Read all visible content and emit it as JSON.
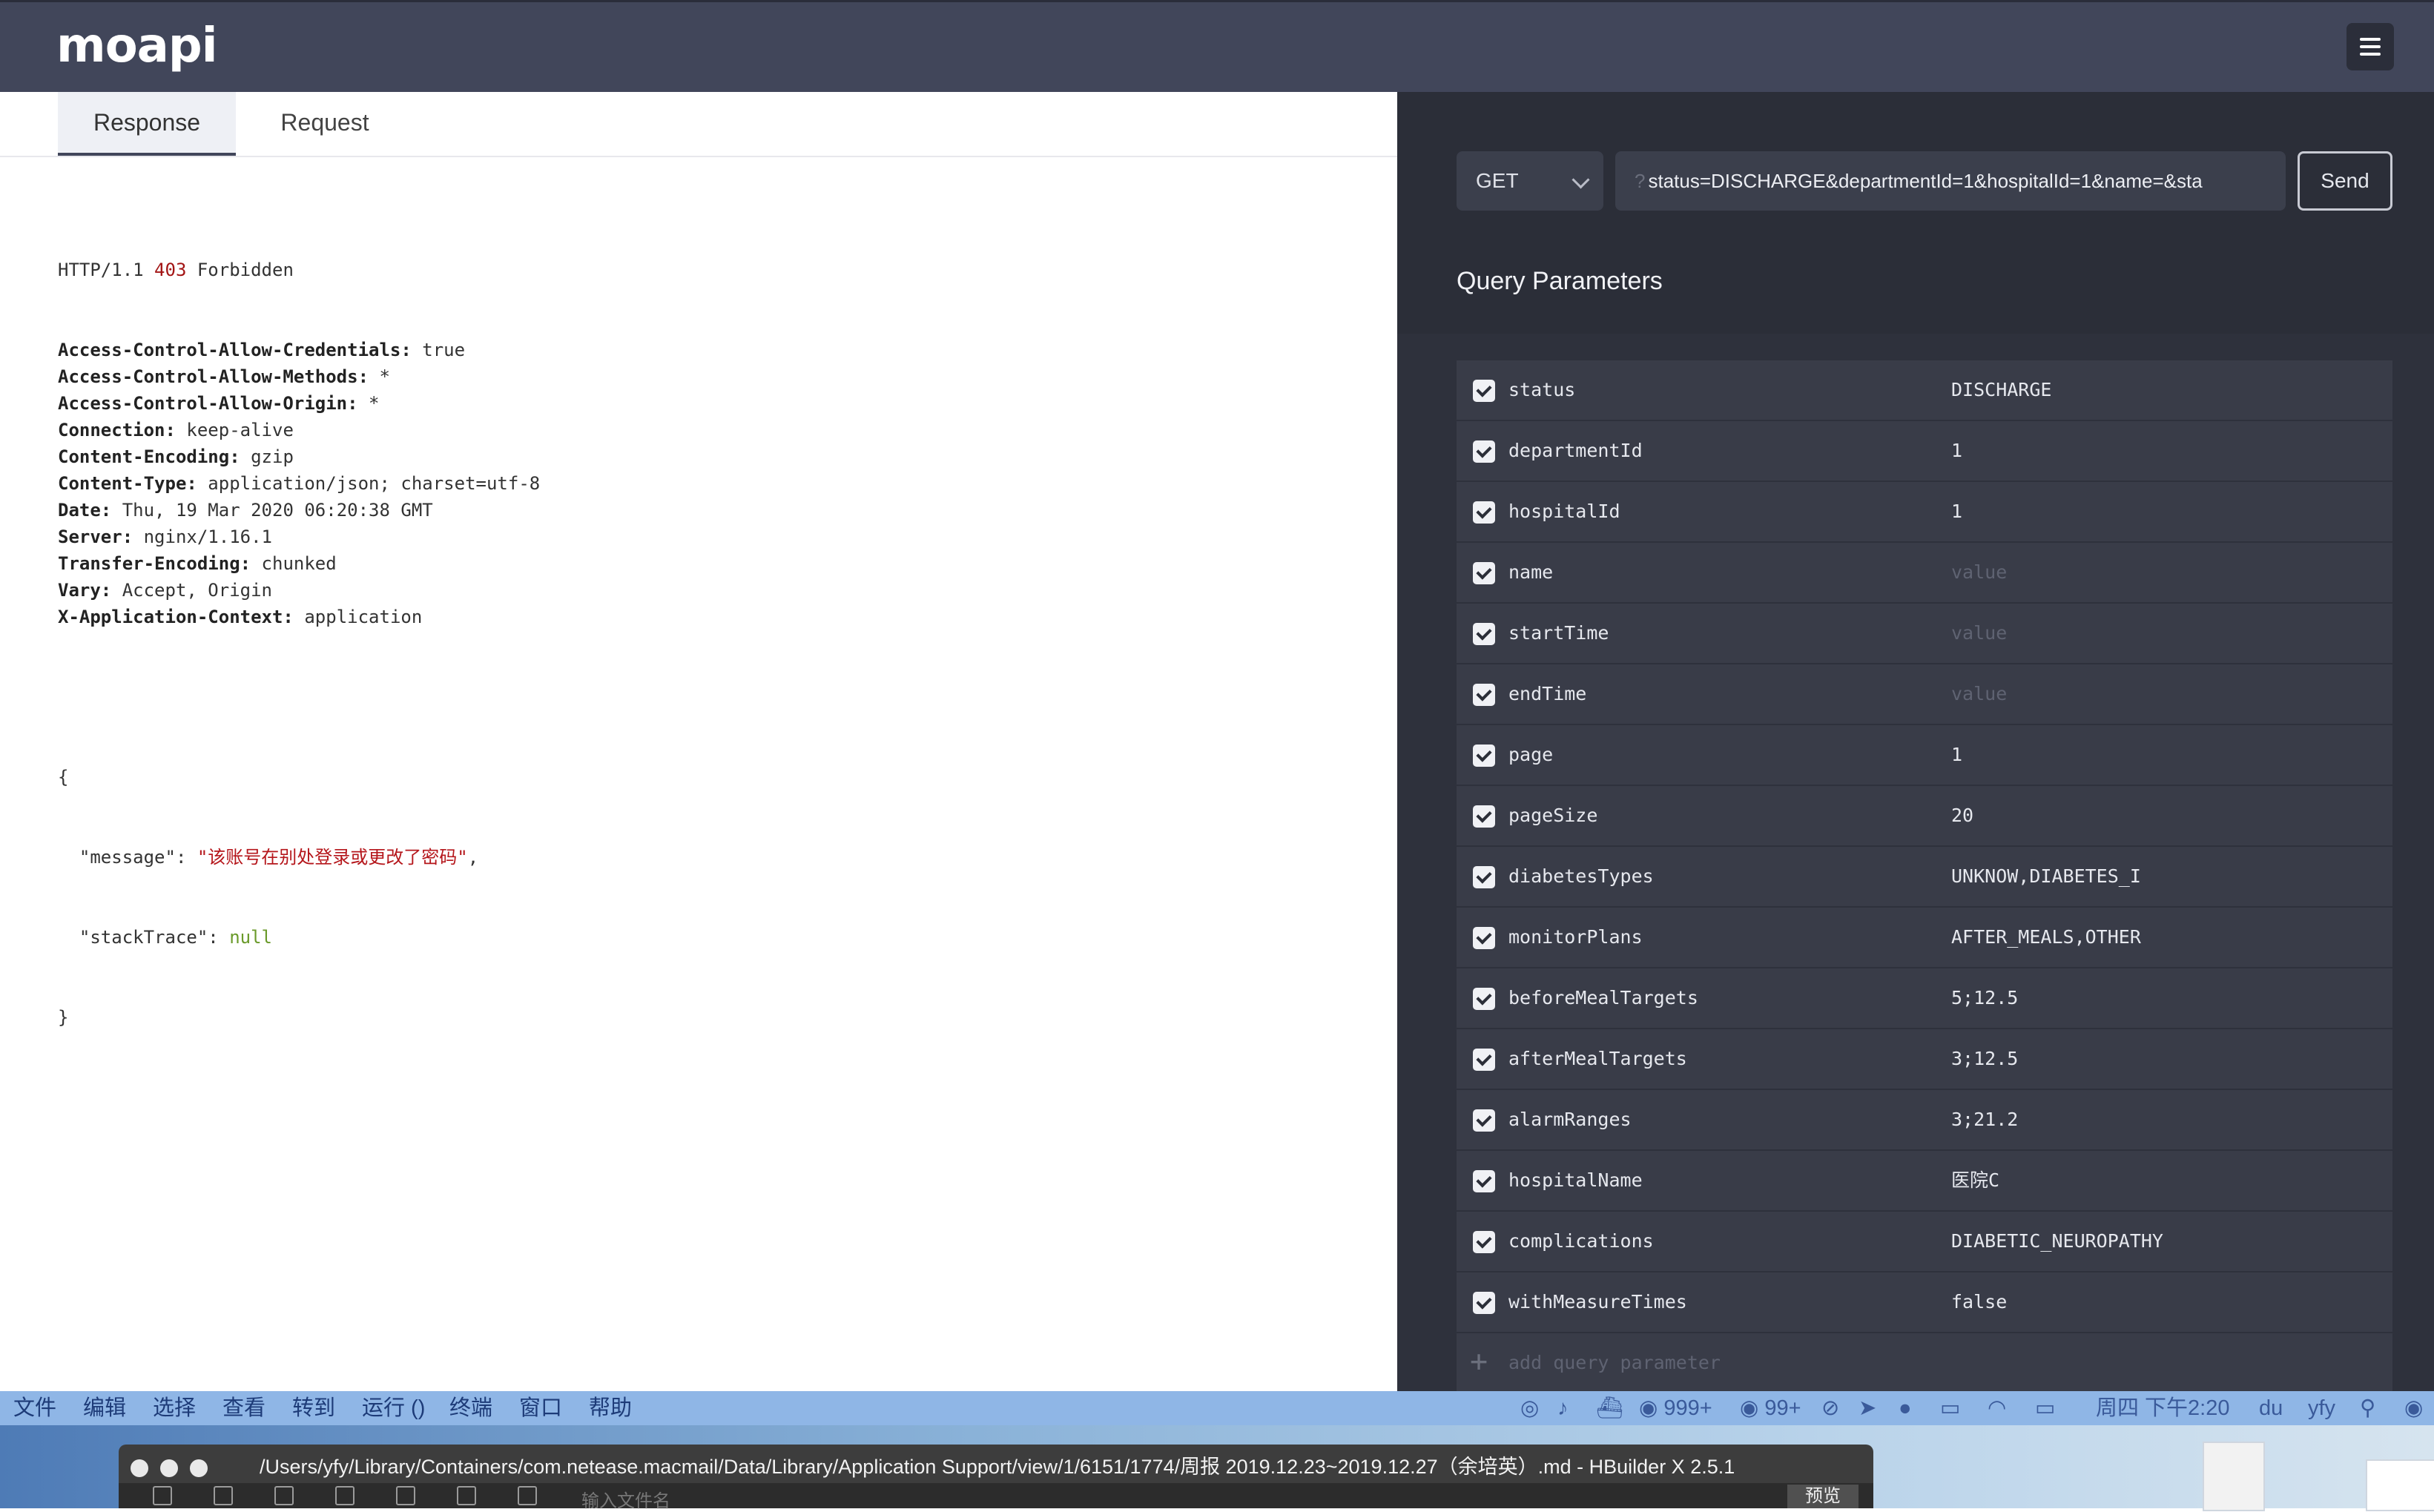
{
  "app": {
    "logo": "moapi",
    "menu_icon": "hamburger-menu-icon"
  },
  "tabs": [
    {
      "label": "Response",
      "active": true
    },
    {
      "label": "Request",
      "active": false
    }
  ],
  "response": {
    "status_protocol": "HTTP/1.1",
    "status_code": "403",
    "status_text": "Forbidden",
    "headers": [
      {
        "key": "Access-Control-Allow-Credentials:",
        "value": "true"
      },
      {
        "key": "Access-Control-Allow-Methods:",
        "value": "*"
      },
      {
        "key": "Access-Control-Allow-Origin:",
        "value": "*"
      },
      {
        "key": "Connection:",
        "value": "keep-alive"
      },
      {
        "key": "Content-Encoding:",
        "value": "gzip"
      },
      {
        "key": "Content-Type:",
        "value": "application/json; charset=utf-8"
      },
      {
        "key": "Date:",
        "value": "Thu, 19 Mar 2020 06:20:38 GMT"
      },
      {
        "key": "Server:",
        "value": "nginx/1.16.1"
      },
      {
        "key": "Transfer-Encoding:",
        "value": "chunked"
      },
      {
        "key": "Vary:",
        "value": "Accept, Origin"
      },
      {
        "key": "X-Application-Context:",
        "value": "application"
      }
    ],
    "body_open": "{",
    "body_message_key": "\"message\":",
    "body_message_value": "\"该账号在别处登录或更改了密码\"",
    "body_message_comma": ",",
    "body_stack_key": "\"stackTrace\":",
    "body_stack_value": "null",
    "body_close": "}"
  },
  "request": {
    "method": "GET",
    "url_prefix": "?",
    "url": "status=DISCHARGE&departmentId=1&hospitalId=1&name=&sta",
    "send_label": "Send",
    "query_title": "Query Parameters",
    "params": [
      {
        "name": "status",
        "value": "DISCHARGE",
        "placeholder": false,
        "checked": true
      },
      {
        "name": "departmentId",
        "value": "1",
        "placeholder": false,
        "checked": true
      },
      {
        "name": "hospitalId",
        "value": "1",
        "placeholder": false,
        "checked": true
      },
      {
        "name": "name",
        "value": "value",
        "placeholder": true,
        "checked": true
      },
      {
        "name": "startTime",
        "value": "value",
        "placeholder": true,
        "checked": true
      },
      {
        "name": "endTime",
        "value": "value",
        "placeholder": true,
        "checked": true
      },
      {
        "name": "page",
        "value": "1",
        "placeholder": false,
        "checked": true
      },
      {
        "name": "pageSize",
        "value": "20",
        "placeholder": false,
        "checked": true
      },
      {
        "name": "diabetesTypes",
        "value": "UNKNOW,DIABETES_I",
        "placeholder": false,
        "checked": true
      },
      {
        "name": "monitorPlans",
        "value": "AFTER_MEALS,OTHER",
        "placeholder": false,
        "checked": true
      },
      {
        "name": "beforeMealTargets",
        "value": "5;12.5",
        "placeholder": false,
        "checked": true
      },
      {
        "name": "afterMealTargets",
        "value": "3;12.5",
        "placeholder": false,
        "checked": true
      },
      {
        "name": "alarmRanges",
        "value": "3;21.2",
        "placeholder": false,
        "checked": true
      },
      {
        "name": "hospitalName",
        "value": "医院C",
        "placeholder": false,
        "checked": true
      },
      {
        "name": "complications",
        "value": "DIABETIC_NEUROPATHY",
        "placeholder": false,
        "checked": true
      },
      {
        "name": "withMeasureTimes",
        "value": "false",
        "placeholder": false,
        "checked": true
      }
    ],
    "add_param_label": "add query parameter"
  },
  "menubar": {
    "items": [
      "文件",
      "编辑",
      "选择",
      "查看",
      "转到",
      "运行 ()",
      "终端",
      "窗口",
      "帮助"
    ],
    "badge1": "999+",
    "badge2": "99+",
    "clock": "周四 下午2:20",
    "user": "yfy"
  },
  "hbuilder": {
    "title": "/Users/yfy/Library/Containers/com.netease.macmail/Data/Library/Application Support/view/1/6151/1774/周报 2019.12.23~2019.12.27（余培英）.md - HBuilder X 2.5.1",
    "file_placeholder": "输入文件名",
    "preview_label": "预览"
  },
  "colors": {
    "header_bg": "#41465a",
    "panel_bg": "#2e313c",
    "row_bg": "#393c48",
    "status_code": "#a31515"
  }
}
